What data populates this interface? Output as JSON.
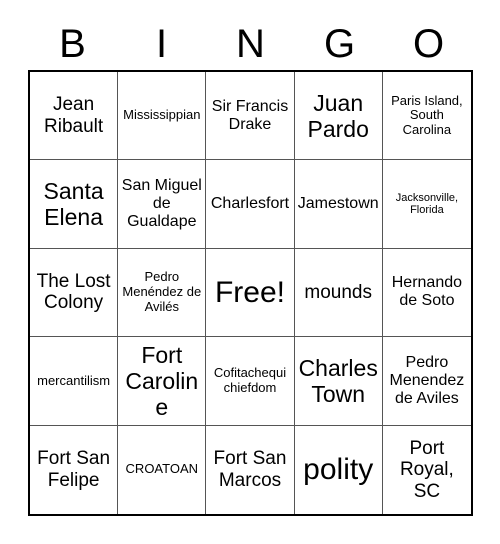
{
  "card": {
    "title": "BINGO card",
    "header_letters": [
      "B",
      "I",
      "N",
      "G",
      "O"
    ],
    "columns": 5,
    "rows": 5,
    "free_space_index": 12,
    "colors": {
      "background": "#ffffff",
      "text": "#000000",
      "outer_border": "#000000",
      "inner_grid_line": "#555555"
    },
    "cells": [
      {
        "text": "Jean Ribault",
        "size": "lg"
      },
      {
        "text": "Mississippian",
        "size": "sm"
      },
      {
        "text": "Sir Francis Drake",
        "size": "md"
      },
      {
        "text": "Juan Pardo",
        "size": "xl"
      },
      {
        "text": "Paris Island, South Carolina",
        "size": "sm"
      },
      {
        "text": "Santa Elena",
        "size": "xl"
      },
      {
        "text": "San Miguel de Gualdape",
        "size": "md"
      },
      {
        "text": "Charlesfort",
        "size": "md"
      },
      {
        "text": "Jamestown",
        "size": "md"
      },
      {
        "text": "Jacksonville, Florida",
        "size": "xs"
      },
      {
        "text": "The Lost Colony",
        "size": "lg"
      },
      {
        "text": "Pedro Menéndez de Avilés",
        "size": "sm"
      },
      {
        "text": "Free!",
        "size": "xxl"
      },
      {
        "text": "mounds",
        "size": "lg"
      },
      {
        "text": "Hernando de Soto",
        "size": "md"
      },
      {
        "text": "mercantilism",
        "size": "sm"
      },
      {
        "text": "Fort Caroline",
        "size": "xl"
      },
      {
        "text": "Cofitachequi chiefdom",
        "size": "sm"
      },
      {
        "text": "Charles Town",
        "size": "xl"
      },
      {
        "text": "Pedro Menendez de Aviles",
        "size": "md"
      },
      {
        "text": "Fort San Felipe",
        "size": "lg"
      },
      {
        "text": "CROATOAN",
        "size": "sm"
      },
      {
        "text": "Fort San Marcos",
        "size": "lg"
      },
      {
        "text": "polity",
        "size": "xxl"
      },
      {
        "text": "Port Royal, SC",
        "size": "lg"
      }
    ]
  }
}
